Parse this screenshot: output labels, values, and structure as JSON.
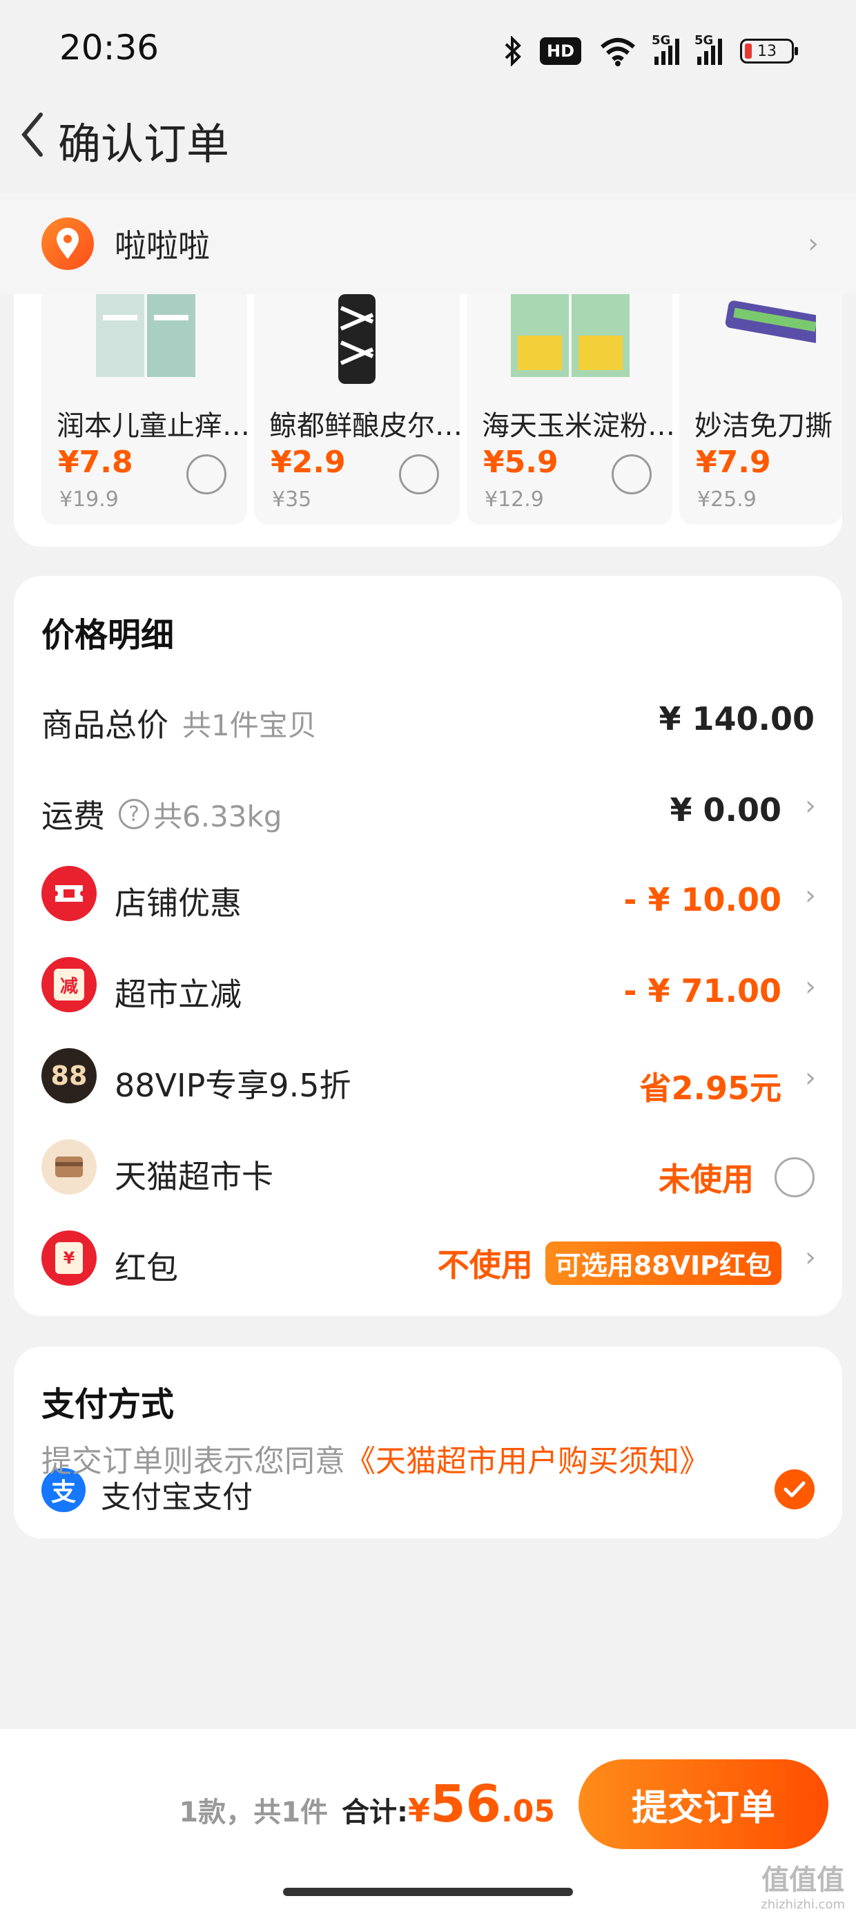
{
  "status_bar": {
    "time": "20:36",
    "hd_badge": "HD",
    "signal_1_label": "5G",
    "signal_2_label": "5G",
    "battery": "13",
    "icons": [
      "bluetooth-icon",
      "hd-voice-icon",
      "wifi-icon",
      "signal-5g-icon",
      "signal-5g-icon",
      "battery-icon"
    ]
  },
  "header": {
    "title": "确认订单"
  },
  "address": {
    "name": "啦啦啦"
  },
  "products": [
    {
      "name": "润本儿童止痒…",
      "price": "¥7.8",
      "original_price": "¥19.9",
      "selected": false
    },
    {
      "name": "鲸都鲜酿皮尔…",
      "price": "¥2.9",
      "original_price": "¥35",
      "selected": false
    },
    {
      "name": "海天玉米淀粉…",
      "price": "¥5.9",
      "original_price": "¥12.9",
      "selected": false
    },
    {
      "name": "妙洁免刀撕",
      "price": "¥7.9",
      "original_price": "¥25.9",
      "selected": false
    }
  ],
  "price_detail": {
    "title": "价格明细",
    "goods_total": {
      "label": "商品总价",
      "sub": "共1件宝贝",
      "value": "¥ 140.00"
    },
    "shipping": {
      "label": "运费",
      "sub": "共6.33kg",
      "value": "¥ 0.00"
    },
    "store_discount": {
      "label": "店铺优惠",
      "value": "- ¥ 10.00"
    },
    "supermarket_cut": {
      "label": "超市立减",
      "value": "- ¥ 71.00",
      "icon_text": "减"
    },
    "vip": {
      "label": "88VIP专享9.5折",
      "value": "省2.95元",
      "icon_text": "88"
    },
    "card": {
      "label": "天猫超市卡",
      "value": "未使用"
    },
    "red_packet": {
      "label": "红包",
      "value": "不使用",
      "badge": "可选用88VIP红包",
      "icon_text": "¥"
    }
  },
  "payment": {
    "title": "支付方式",
    "method": "支付宝支付",
    "icon_text": "支",
    "selected": true
  },
  "agreement": {
    "prefix": "提交订单则表示您同意",
    "link": "《天猫超市用户购买须知》"
  },
  "bottom": {
    "count_text": "1款，共1件",
    "total_label": "合计:",
    "currency": "¥",
    "total_int": "56",
    "total_dec": ".05",
    "submit_label": "提交订单"
  },
  "watermark": {
    "main": "值值值",
    "sub": "zhizhizhi.com"
  },
  "colors": {
    "accent": "#ff5a00",
    "background": "#f2f2f2",
    "card": "#ffffff"
  }
}
